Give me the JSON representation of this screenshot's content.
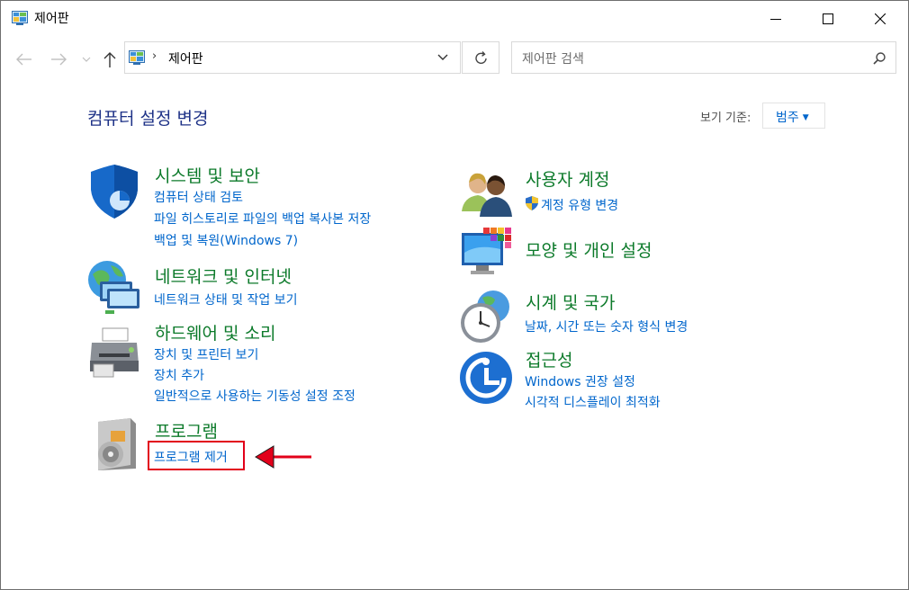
{
  "window": {
    "title": "제어판",
    "controls": {
      "minimize": "minimize",
      "maximize": "maximize",
      "close": "close"
    }
  },
  "address": {
    "separator": "›",
    "path": "제어판"
  },
  "search": {
    "placeholder": "제어판 검색"
  },
  "page": {
    "title": "컴퓨터 설정 변경",
    "view_by_label": "보기 기준:",
    "view_by_value": "범주"
  },
  "categories": {
    "system": {
      "title": "시스템 및 보안",
      "links": [
        "컴퓨터 상태 검토",
        "파일 히스토리로 파일의 백업 복사본 저장",
        "백업 및 복원(Windows 7)"
      ]
    },
    "network": {
      "title": "네트워크 및 인터넷",
      "links": [
        "네트워크 상태 및 작업 보기"
      ]
    },
    "hardware": {
      "title": "하드웨어 및 소리",
      "links": [
        "장치 및 프린터 보기",
        "장치 추가",
        "일반적으로 사용하는 기동성 설정 조정"
      ]
    },
    "programs": {
      "title": "프로그램",
      "links": [
        "프로그램 제거"
      ]
    },
    "users": {
      "title": "사용자 계정",
      "links": [
        "계정 유형 변경"
      ]
    },
    "appearance": {
      "title": "모양 및 개인 설정",
      "links": []
    },
    "clock": {
      "title": "시계 및 국가",
      "links": [
        "날짜, 시간 또는 숫자 형식 변경"
      ]
    },
    "access": {
      "title": "접근성",
      "links": [
        "Windows 권장 설정",
        "시각적 디스플레이 최적화"
      ]
    }
  },
  "icons": {
    "system": "shield-icon",
    "network": "network-globe-icon",
    "hardware": "printer-icon",
    "programs": "program-disc-icon",
    "users": "users-icon",
    "appearance": "monitor-palette-icon",
    "clock": "clock-globe-icon",
    "access": "accessibility-icon",
    "uac": "uac-shield-icon"
  },
  "colors": {
    "category_title": "#0c7a2a",
    "link": "#0066cc",
    "page_title": "#1e3287",
    "annotation": "#e2001a"
  }
}
